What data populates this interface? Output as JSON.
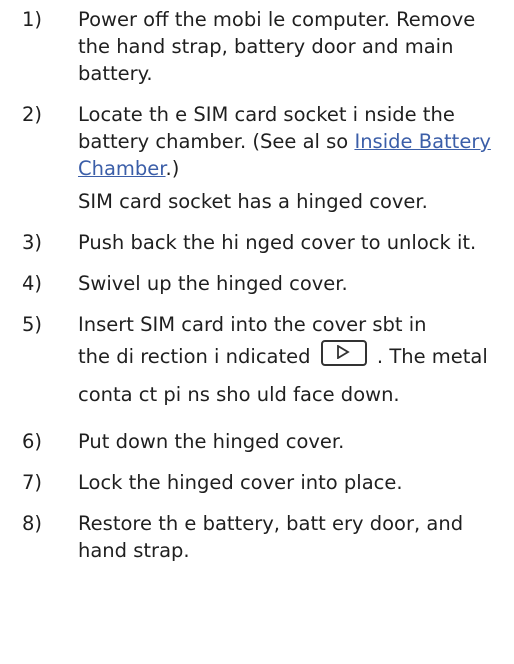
{
  "steps": [
    {
      "num": "1)",
      "text": "Power off the mobi le computer. Remove the hand strap, battery door and main battery."
    },
    {
      "num": "2)",
      "text_before": "Locate th e SIM card socket i nside the battery chamber. (See al so ",
      "link": "Inside Battery Chamber",
      "text_after": ".)",
      "note": "SIM card socket has a hinged cover."
    },
    {
      "num": "3)",
      "text": "Push back the hi nged cover to unlock it."
    },
    {
      "num": "4)",
      "text": "Swivel up the hinged cover."
    },
    {
      "num": "5)",
      "text_line1": "Insert SIM card into the cover sbt in",
      "text_before_icon": "the di rection i ndicated",
      "text_after_icon": ". The metal conta ct pi ns sho uld face down.",
      "icon": "play-direction-icon"
    },
    {
      "num": "6)",
      "text": "Put down the hinged cover."
    },
    {
      "num": "7)",
      "text": "Lock the hinged cover into place."
    },
    {
      "num": "8)",
      "text": "Restore th e battery, batt ery door, and hand strap."
    }
  ],
  "colors": {
    "text": "#1f1f1f",
    "link": "#3b5ea8"
  }
}
